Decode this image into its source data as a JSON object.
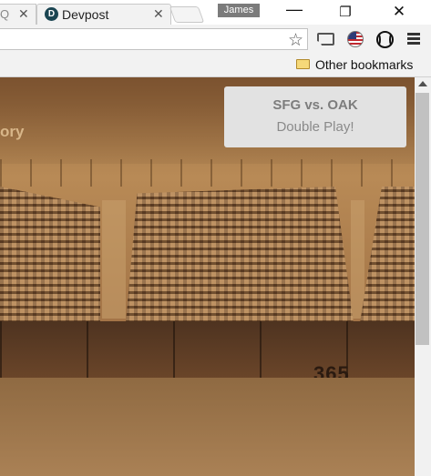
{
  "tabs": {
    "prev_close": "✕",
    "active": {
      "favicon_letter": "D",
      "title": "Devpost",
      "close": "✕"
    }
  },
  "profile": {
    "name": "James"
  },
  "window_controls": {
    "minimize": "—",
    "restore": "❐",
    "close": "✕"
  },
  "toolbar": {
    "bookmark_star": "☆"
  },
  "bookmarks_bar": {
    "other_bookmarks": "Other bookmarks"
  },
  "page": {
    "left_fragment": "ory",
    "wall_sign": "365"
  },
  "notification": {
    "title": "SFG vs. OAK",
    "message": "Double Play!"
  },
  "colors": {
    "notification_bg": "#e2e2e2",
    "sepia_page": "#a97c4b",
    "devpost_favicon": "#1b4552"
  }
}
